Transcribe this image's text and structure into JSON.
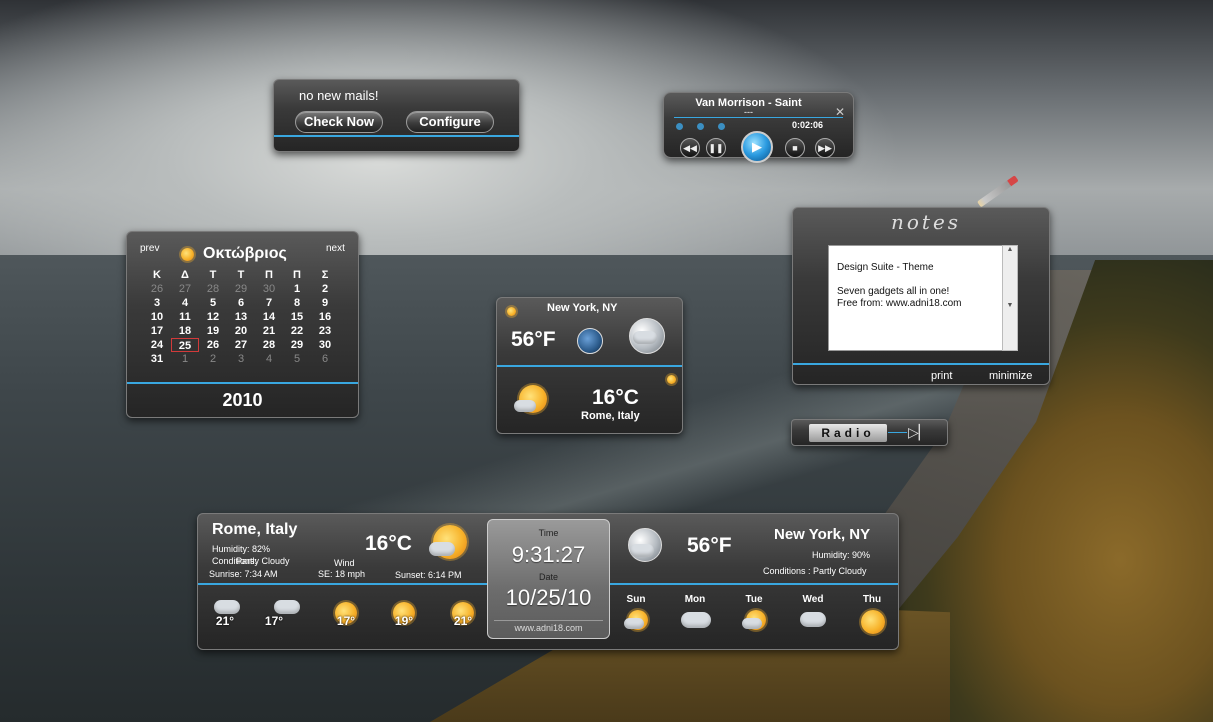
{
  "mail": {
    "message": "no new mails!",
    "check_label": "Check Now",
    "configure_label": "Configure"
  },
  "player": {
    "track_title": "Van Morrison - Saint",
    "track_sub": "---",
    "elapsed": "0:02:06",
    "close_glyph": "✕",
    "controls": [
      "rewind-icon",
      "pause-icon",
      "play-icon",
      "stop-icon",
      "forward-icon"
    ]
  },
  "calendar": {
    "prev_label": "prev",
    "next_label": "next",
    "month": "Οκτώβριος",
    "year": "2010",
    "weekdays": [
      "Κ",
      "Δ",
      "Τ",
      "Τ",
      "Π",
      "Π",
      "Σ"
    ],
    "weeks": [
      [
        "26",
        "27",
        "28",
        "29",
        "30",
        "1",
        "2"
      ],
      [
        "3",
        "4",
        "5",
        "6",
        "7",
        "8",
        "9"
      ],
      [
        "10",
        "11",
        "12",
        "13",
        "14",
        "15",
        "16"
      ],
      [
        "17",
        "18",
        "19",
        "20",
        "21",
        "22",
        "23"
      ],
      [
        "24",
        "25",
        "26",
        "27",
        "28",
        "29",
        "30"
      ],
      [
        "31",
        "1",
        "2",
        "3",
        "4",
        "5",
        "6"
      ]
    ],
    "today": "25"
  },
  "weather_small": {
    "city": "New York, NY",
    "temp_f": "56°F",
    "temp_c": "16°C",
    "city2": "Rome, Italy"
  },
  "notes": {
    "title": "notes",
    "lines": [
      "Design Suite - Theme",
      "",
      "Seven gadgets all in one!",
      "Free from: www.adni18.com"
    ],
    "print_label": "print",
    "minimize_label": "minimize"
  },
  "radio": {
    "label": "Radio"
  },
  "bigbar": {
    "left_city": "Rome, Italy",
    "left_temp": "16°C",
    "humidity": "Humidity: 82%",
    "conditions": "Conditions:",
    "overlay_cond": "Partly Cloudy",
    "wind_label": "Wind",
    "wind": "SE: 18 mph",
    "sunrise": "Sunrise: 7:34 AM",
    "sunset": "Sunset: 6:14 PM",
    "right_city": "New York, NY",
    "right_temp": "56°F",
    "right_humidity": "Humidity: 90%",
    "right_conditions": "Conditions :  Partly Cloudy",
    "clock": {
      "time_label": "Time",
      "time": "9:31:27",
      "date_label": "Date",
      "date": "10/25/10",
      "url": "www.adni18.com"
    },
    "forecast_left": [
      {
        "temp": "21°",
        "icon": "rain-cloud-icon"
      },
      {
        "temp": "17°",
        "icon": "rain-cloud-icon"
      },
      {
        "temp": "17°",
        "icon": "sun-icon"
      },
      {
        "temp": "19°",
        "icon": "sun-icon"
      },
      {
        "temp": "21°",
        "icon": "sun-icon"
      }
    ],
    "forecast_right": [
      {
        "day": "Sun",
        "icon": "partly-cloudy-icon"
      },
      {
        "day": "Mon",
        "icon": "cloudy-icon"
      },
      {
        "day": "Tue",
        "icon": "partly-cloudy-icon"
      },
      {
        "day": "Wed",
        "icon": "rain-cloud-icon"
      },
      {
        "day": "Thu",
        "icon": "sun-icon"
      }
    ]
  },
  "colors": {
    "accent": "#39a7e0",
    "today_ring": "#d23a3a"
  }
}
